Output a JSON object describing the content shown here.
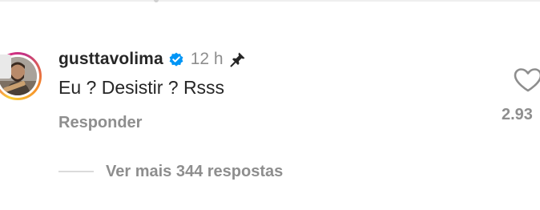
{
  "comment": {
    "username": "gusttavolima",
    "verified": true,
    "time": "12 h",
    "pinned": true,
    "text": "Eu ? Desistir ? Rsss",
    "reply_label": "Responder",
    "like_count": "2.93",
    "view_replies_label": "Ver mais 344 respostas"
  },
  "icons": {
    "verified": "verified-badge-icon",
    "pin": "pin-icon",
    "like": "heart-outline-icon"
  },
  "colors": {
    "verified_blue": "#0095f6",
    "text_primary": "#262626",
    "text_secondary": "#8e8e8e"
  }
}
